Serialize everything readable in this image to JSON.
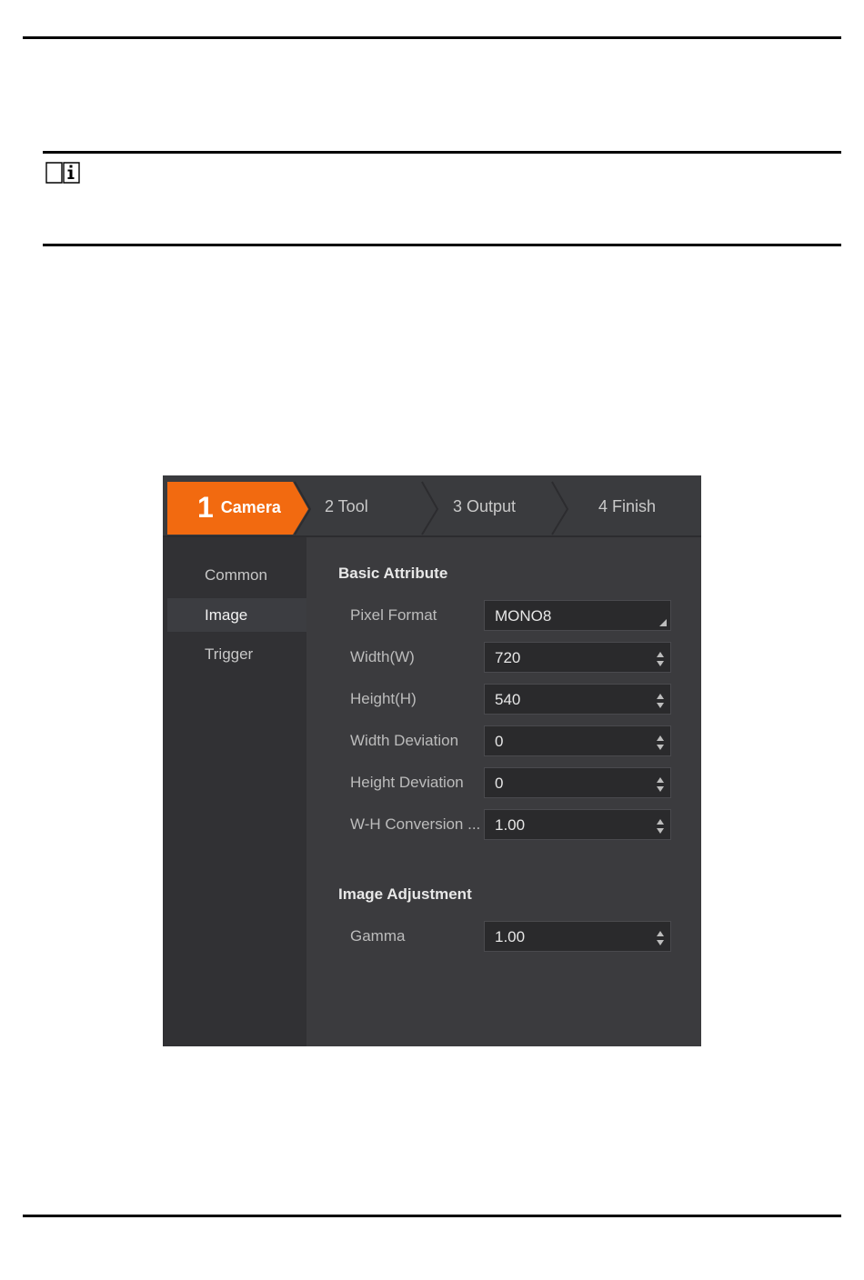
{
  "steps": [
    {
      "num": "1",
      "label": "Camera"
    },
    {
      "label": "2 Tool"
    },
    {
      "label": "3 Output"
    },
    {
      "label": "4 Finish"
    }
  ],
  "sidebar": {
    "items": [
      "Common",
      "Image",
      "Trigger"
    ],
    "active": "Image"
  },
  "basic_attribute": {
    "title": "Basic Attribute",
    "fields": [
      {
        "label": "Pixel Format",
        "value": "MONO8",
        "control": "dropdown"
      },
      {
        "label": "Width(W)",
        "value": "720",
        "control": "spinner"
      },
      {
        "label": "Height(H)",
        "value": "540",
        "control": "spinner"
      },
      {
        "label": "Width Deviation",
        "value": "0",
        "control": "spinner"
      },
      {
        "label": "Height Deviation",
        "value": "0",
        "control": "spinner"
      },
      {
        "label": "W-H Conversion ...",
        "value": "1.00",
        "control": "spinner"
      }
    ]
  },
  "image_adjustment": {
    "title": "Image Adjustment",
    "fields": [
      {
        "label": "Gamma",
        "value": "1.00",
        "control": "spinner"
      }
    ]
  },
  "icons": {
    "note": "note-book-info-icon",
    "spinner": "spinner-arrows-icon",
    "dropdown": "dropdown-corner-icon"
  },
  "colors": {
    "accent": "#f26a10",
    "background": "#2c2c2f",
    "panel": "#3b3b3e"
  }
}
